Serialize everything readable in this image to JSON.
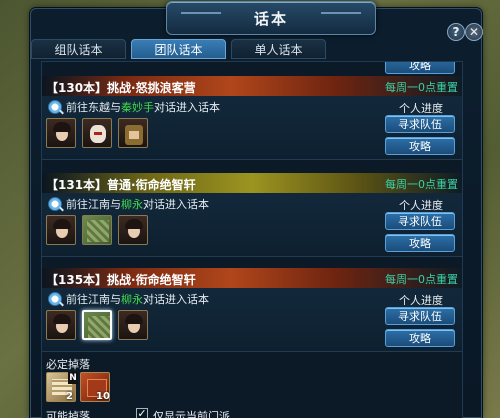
{
  "window": {
    "title": "话本",
    "help_glyph": "?",
    "close_glyph": "✕"
  },
  "tabs": [
    {
      "label": "组队话本",
      "active": false
    },
    {
      "label": "团队话本",
      "active": true
    },
    {
      "label": "单人话本",
      "active": false
    }
  ],
  "top_button_label": "攻略",
  "dungeons": [
    {
      "title": "【130本】挑战·怒挑浪客营",
      "reset": "每周一0点重置",
      "quest_prefix": "前往东越与",
      "npc": "秦妙手",
      "quest_suffix": "对话进入话本",
      "progress_label": "个人进度",
      "find_team": "寻求队伍",
      "guide": "攻略",
      "header_color": "#b0461b",
      "portraits": [
        "face",
        "mask",
        "warrior"
      ]
    },
    {
      "title": "【131本】普通·衔命绝智轩",
      "reset": "每周一0点重置",
      "quest_prefix": "前往江南与",
      "npc": "柳永",
      "quest_suffix": "对话进入话本",
      "progress_label": "个人进度",
      "find_team": "寻求队伍",
      "guide": "攻略",
      "header_color": "#9c9420",
      "portraits": [
        "face",
        "map",
        "face"
      ]
    },
    {
      "title": "【135本】挑战·衔命绝智轩",
      "reset": "每周一0点重置",
      "quest_prefix": "前往江南与",
      "npc": "柳永",
      "quest_suffix": "对话进入话本",
      "progress_label": "个人进度",
      "find_team": "寻求队伍",
      "guide": "攻略",
      "header_color": "#b0461b",
      "portraits": [
        "face",
        "map",
        "face"
      ]
    }
  ],
  "drops": {
    "label": "必定掉落",
    "badge": "N",
    "items": [
      {
        "icon": "scroll-bundle-icon",
        "count": "2"
      },
      {
        "icon": "red-chest-icon",
        "count": "10"
      }
    ]
  },
  "possible_drops": {
    "label": "可能掉落",
    "checkbox_glyph": "✓",
    "checkbox_label": "仅显示当前门派",
    "checked": true
  }
}
